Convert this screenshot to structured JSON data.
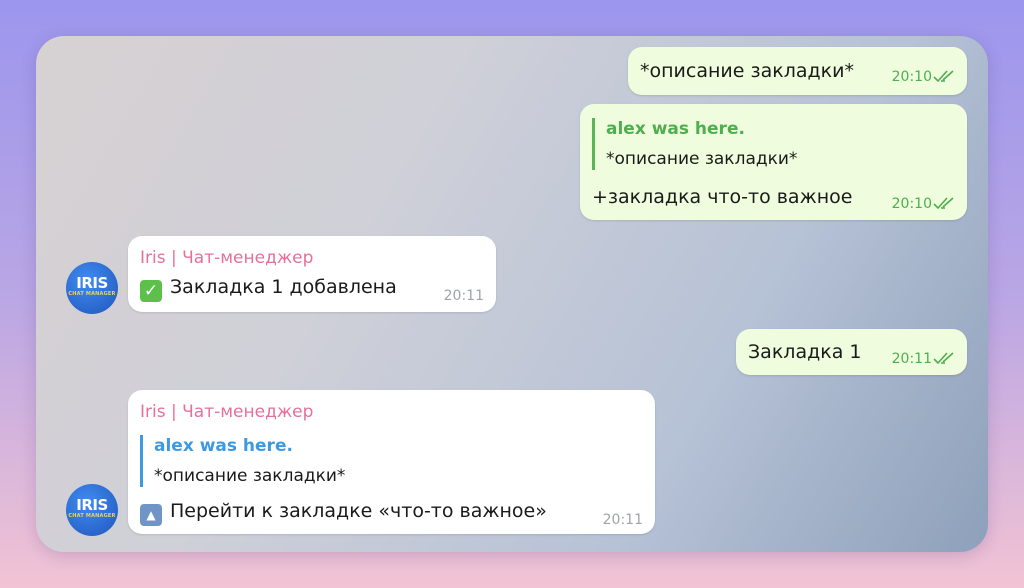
{
  "messages": [
    {
      "id": "m1",
      "direction": "outgoing",
      "text": "*описание закладки*",
      "time": "20:10",
      "status_icon": "double-check-icon"
    },
    {
      "id": "m2",
      "direction": "outgoing",
      "reply": {
        "author": "alex was here.",
        "text": "*описание закладки*"
      },
      "text": "+закладка что-то важное",
      "time": "20:10",
      "status_icon": "double-check-icon"
    },
    {
      "id": "m3",
      "direction": "incoming",
      "sender": "Iris | Чат-менеджер",
      "emoji": "✓",
      "text": "Закладка 1 добавлена",
      "time": "20:11"
    },
    {
      "id": "m4",
      "direction": "outgoing",
      "text": "Закладка 1",
      "time": "20:11",
      "status_icon": "double-check-icon"
    },
    {
      "id": "m5",
      "direction": "incoming",
      "sender": "Iris | Чат-менеджер",
      "reply": {
        "author": "alex was here.",
        "text": "*описание закладки*"
      },
      "emoji": "▲",
      "text": "Перейти к закладке «что-то важное»",
      "time": "20:11"
    }
  ],
  "avatar": {
    "label": "IRIS",
    "sublabel": "CHAT MANAGER"
  },
  "colors": {
    "outgoing_bubble": "#effdde",
    "incoming_bubble": "#ffffff",
    "sender_name": "#e5709b",
    "reply_green": "#4fae4e",
    "reply_blue": "#3d9ae2",
    "avatar_bg": "#2a66cc"
  }
}
